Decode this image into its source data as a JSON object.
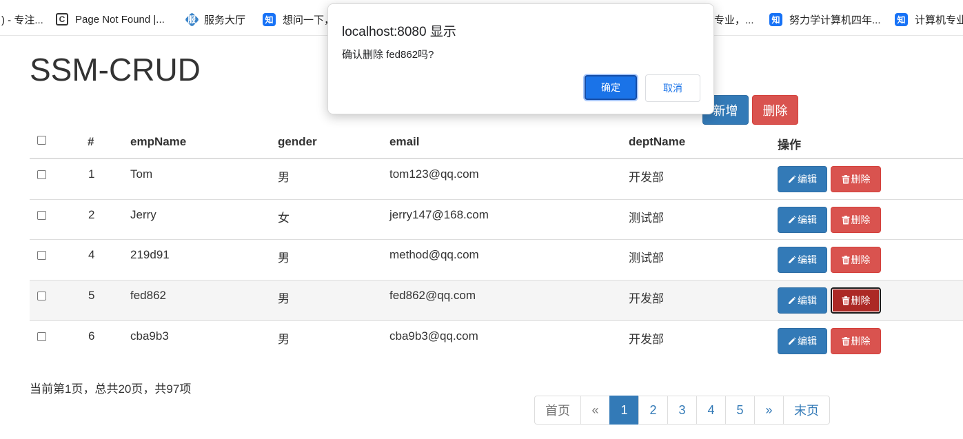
{
  "bookmarks": [
    {
      "label": ") - 专注...",
      "icon": "blank-icon"
    },
    {
      "label": "Page Not Found |...",
      "icon": "csdn-icon"
    },
    {
      "label": "服务大厅",
      "icon": "service-hall-icon"
    },
    {
      "label": "想问一下，",
      "icon": "zhihu-icon"
    },
    {
      "label": "专业，...",
      "icon": "none"
    },
    {
      "label": "努力学计算机四年...",
      "icon": "zhihu-icon"
    },
    {
      "label": "计算机专业",
      "icon": "zhihu-icon"
    }
  ],
  "icons": {
    "zhihu_glyph": "知",
    "csdn_glyph": "C",
    "service_glyph": "服"
  },
  "page": {
    "title": "SSM-CRUD"
  },
  "toolbar": {
    "add_label": "新增",
    "delete_label": "删除"
  },
  "table": {
    "headers": [
      "#",
      "empName",
      "gender",
      "email",
      "deptName",
      "操作"
    ],
    "rows": [
      {
        "id": "1",
        "empName": "Tom",
        "gender": "男",
        "email": "tom123@qq.com",
        "deptName": "开发部"
      },
      {
        "id": "2",
        "empName": "Jerry",
        "gender": "女",
        "email": "jerry147@168.com",
        "deptName": "测试部"
      },
      {
        "id": "4",
        "empName": "219d91",
        "gender": "男",
        "email": "method@qq.com",
        "deptName": "测试部"
      },
      {
        "id": "5",
        "empName": "fed862",
        "gender": "男",
        "email": "fed862@qq.com",
        "deptName": "开发部"
      },
      {
        "id": "6",
        "empName": "cba9b3",
        "gender": "男",
        "email": "cba9b3@qq.com",
        "deptName": "开发部"
      }
    ],
    "edit_label": "编辑",
    "delete_label": "删除"
  },
  "pagination": {
    "info": "当前第1页，总共20页，共97项",
    "items": [
      "首页",
      "«",
      "1",
      "2",
      "3",
      "4",
      "5",
      "»",
      "末页"
    ],
    "active": "1"
  },
  "dialog": {
    "title": "localhost:8080 显示",
    "message": "确认删除 fed862吗?",
    "ok_label": "确定",
    "cancel_label": "取消"
  },
  "colors": {
    "primary": "#337ab7",
    "danger": "#d9534f",
    "dialog_button": "#1a73e8"
  }
}
